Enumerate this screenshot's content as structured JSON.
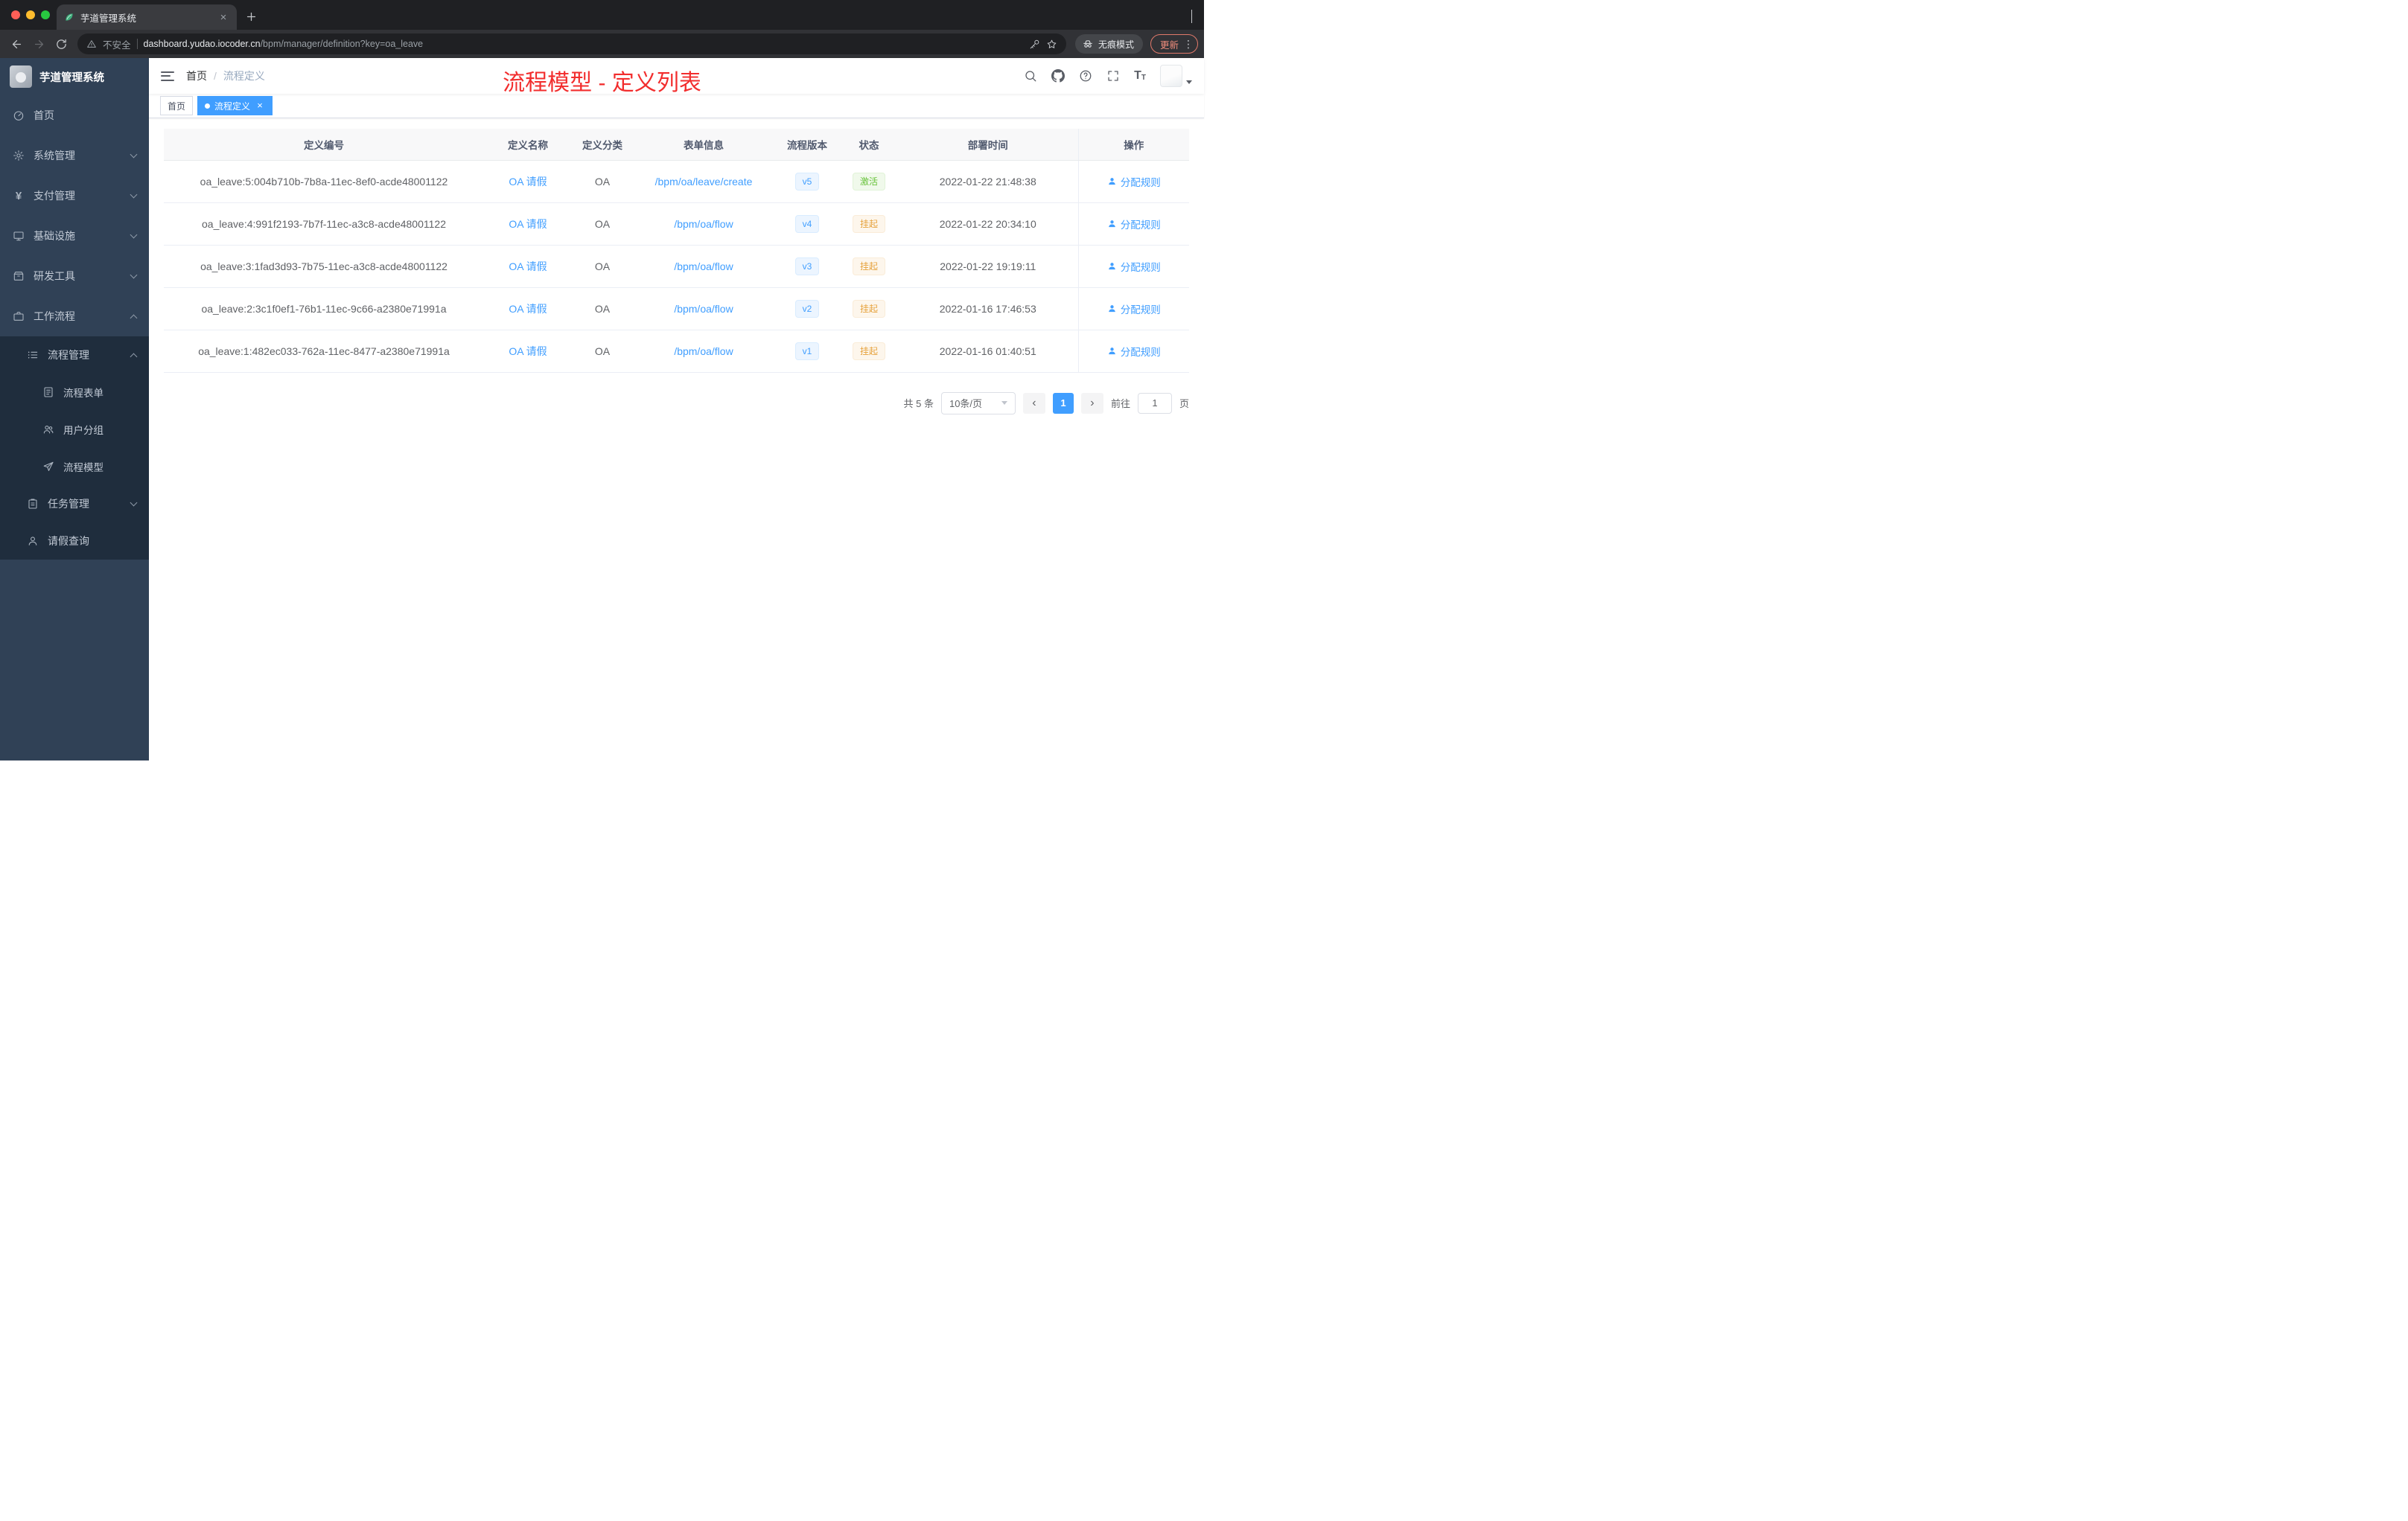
{
  "colors": {
    "accent": "#409eff",
    "success": "#67c23a",
    "warning": "#e6a23c",
    "annotation_red": "#f22d2d",
    "sidebar_bg": "#304156",
    "submenu_bg": "#1f2d3d"
  },
  "glyphs": {
    "close": "×",
    "kebab": "⋮",
    "yen": "¥",
    "prev": "‹",
    "next": "›",
    "font_large": "T",
    "font_small": "T"
  },
  "browser": {
    "tab_title": "芋道管理系统",
    "security_label": "不安全",
    "url_domain": "dashboard.yudao.iocoder.cn",
    "url_path": "/bpm/manager/definition?key=oa_leave",
    "incognito_label": "无痕模式",
    "update_label": "更新"
  },
  "sidebar": {
    "app_title": "芋道管理系统",
    "items": [
      {
        "label": "首页"
      },
      {
        "label": "系统管理"
      },
      {
        "label": "支付管理"
      },
      {
        "label": "基础设施"
      },
      {
        "label": "研发工具"
      },
      {
        "label": "工作流程"
      }
    ],
    "submenu": {
      "process_mgmt": "流程管理",
      "children": [
        "流程表单",
        "用户分组",
        "流程模型"
      ],
      "task_mgmt": "任务管理",
      "leave_query": "请假查询"
    }
  },
  "header": {
    "breadcrumb": [
      "首页",
      "流程定义"
    ],
    "breadcrumb_sep": "/",
    "annotation": "流程模型 - 定义列表"
  },
  "tags": {
    "items": [
      {
        "label": "首页"
      },
      {
        "label": "流程定义"
      }
    ]
  },
  "table": {
    "columns": [
      "定义编号",
      "定义名称",
      "定义分类",
      "表单信息",
      "流程版本",
      "状态",
      "部署时间",
      "操作"
    ],
    "rows": [
      {
        "id": "oa_leave:5:004b710b-7b8a-11ec-8ef0-acde48001122",
        "name": "OA 请假",
        "category": "OA",
        "form": "/bpm/oa/leave/create",
        "version": "v5",
        "status": "激活",
        "status_class": "tag tag-success",
        "deploy_time": "2022-01-22 21:48:38",
        "action": "分配规则"
      },
      {
        "id": "oa_leave:4:991f2193-7b7f-11ec-a3c8-acde48001122",
        "name": "OA 请假",
        "category": "OA",
        "form": "/bpm/oa/flow",
        "version": "v4",
        "status": "挂起",
        "status_class": "tag tag-warning",
        "deploy_time": "2022-01-22 20:34:10",
        "action": "分配规则"
      },
      {
        "id": "oa_leave:3:1fad3d93-7b75-11ec-a3c8-acde48001122",
        "name": "OA 请假",
        "category": "OA",
        "form": "/bpm/oa/flow",
        "version": "v3",
        "status": "挂起",
        "status_class": "tag tag-warning",
        "deploy_time": "2022-01-22 19:19:11",
        "action": "分配规则"
      },
      {
        "id": "oa_leave:2:3c1f0ef1-76b1-11ec-9c66-a2380e71991a",
        "name": "OA 请假",
        "category": "OA",
        "form": "/bpm/oa/flow",
        "version": "v2",
        "status": "挂起",
        "status_class": "tag tag-warning",
        "deploy_time": "2022-01-16 17:46:53",
        "action": "分配规则"
      },
      {
        "id": "oa_leave:1:482ec033-762a-11ec-8477-a2380e71991a",
        "name": "OA 请假",
        "category": "OA",
        "form": "/bpm/oa/flow",
        "version": "v1",
        "status": "挂起",
        "status_class": "tag tag-warning",
        "deploy_time": "2022-01-16 01:40:51",
        "action": "分配规则"
      }
    ]
  },
  "pagination": {
    "total": "共 5 条",
    "page_size": "10条/页",
    "current_page": "1",
    "jump_prefix": "前往",
    "jump_value": "1",
    "jump_suffix": "页"
  }
}
